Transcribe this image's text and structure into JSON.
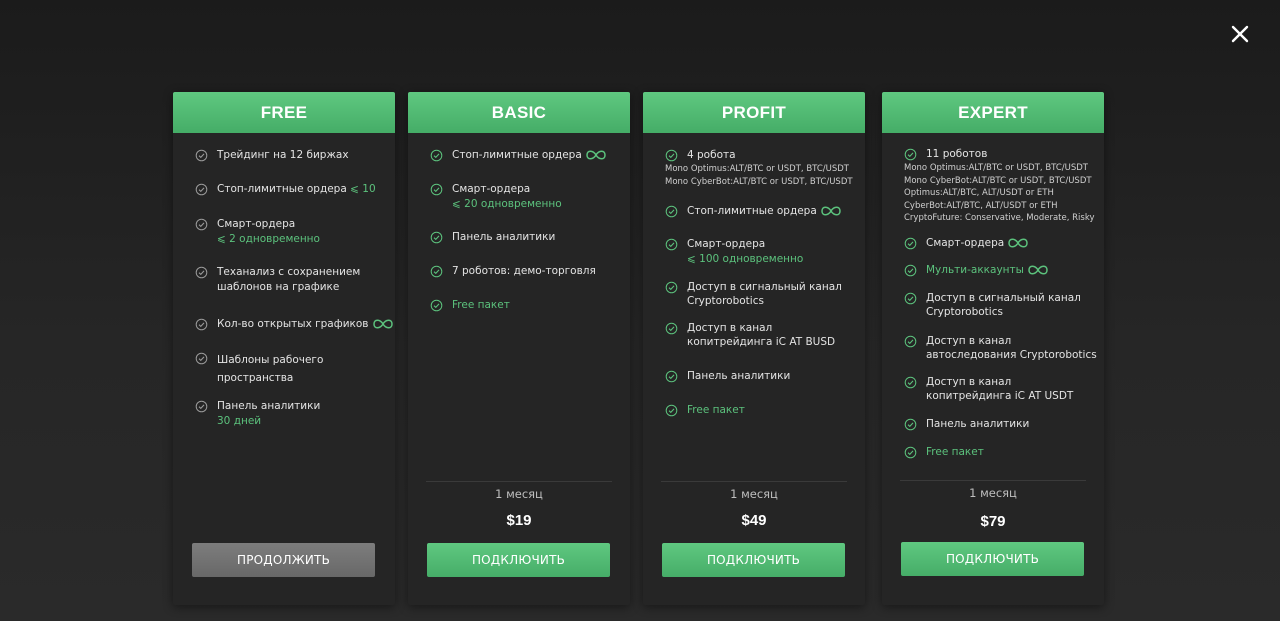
{
  "modal": {
    "close_icon": "close-icon"
  },
  "colors": {
    "accent_green": "#4fb872",
    "card_bg": "#252525",
    "page_bg": "#222222",
    "button_gray": "#747474"
  },
  "plans": {
    "free": {
      "title": "FREE",
      "f1": "Трейдинг на 12 биржах",
      "f2": "Стоп-лимитные ордера",
      "f2_val": "⩽ 10",
      "f3": "Смарт-ордера",
      "f3_sub": "⩽ 2 одновременно",
      "f4": "Теханализ с сохранением шаблонов на графике",
      "f5": "Кол-во открытых графиков",
      "f6": "Шаблоны рабочего пространства",
      "f7": "Панель аналитики",
      "f7_sub": "30 дней",
      "button": "ПРОДОЛЖИТЬ"
    },
    "basic": {
      "title": "BASIC",
      "f1": "Стоп-лимитные ордера",
      "f2": "Смарт-ордера",
      "f2_sub": "⩽ 20 одновременно",
      "f3": "Панель аналитики",
      "f4": "7 роботов: демо-торговля",
      "f5": "Free пакет",
      "period": "1 месяц",
      "price": "$19",
      "button": "ПОДКЛЮЧИТЬ"
    },
    "profit": {
      "title": "PROFIT",
      "f1": "4 робота",
      "f1_d1": "Mono Optimus:ALT/BTC or USDT, BTC/USDT",
      "f1_d2": "Mono CyberBot:ALT/BTC or USDT, BTC/USDT",
      "f2": "Стоп-лимитные ордера",
      "f3": "Смарт-ордера",
      "f3_sub": "⩽ 100 одновременно",
      "f4": "Доступ в сигнальный канал Cryptorobotics",
      "f5": "Доступ в канал копитрейдинга iC AT BUSD",
      "f6": "Панель аналитики",
      "f7": "Free пакет",
      "period": "1 месяц",
      "price": "$49",
      "button": "ПОДКЛЮЧИТЬ"
    },
    "expert": {
      "title": "EXPERT",
      "f1": "11 роботов",
      "f1_d1": "Mono Optimus:ALT/BTC or USDT, BTC/USDT",
      "f1_d2": "Mono CyberBot:ALT/BTC or USDT, BTC/USDT",
      "f1_d3": "Optimus:ALT/BTC, ALT/USDT or ETH",
      "f1_d4": "CyberBot:ALT/BTC, ALT/USDT or ETH",
      "f1_d5": "CryptoFuture: Conservative, Moderate, Risky",
      "f2": "Смарт-ордера",
      "f3": "Мульти-аккаунты",
      "f4": "Доступ в сигнальный канал Cryptorobotics",
      "f5": "Доступ в канал автоследования Cryptorobotics",
      "f6": "Доступ в канал копитрейдинга iC AT USDT",
      "f7": "Панель аналитики",
      "f8": "Free пакет",
      "period": "1 месяц",
      "price": "$79",
      "button": "ПОДКЛЮЧИТЬ"
    }
  }
}
